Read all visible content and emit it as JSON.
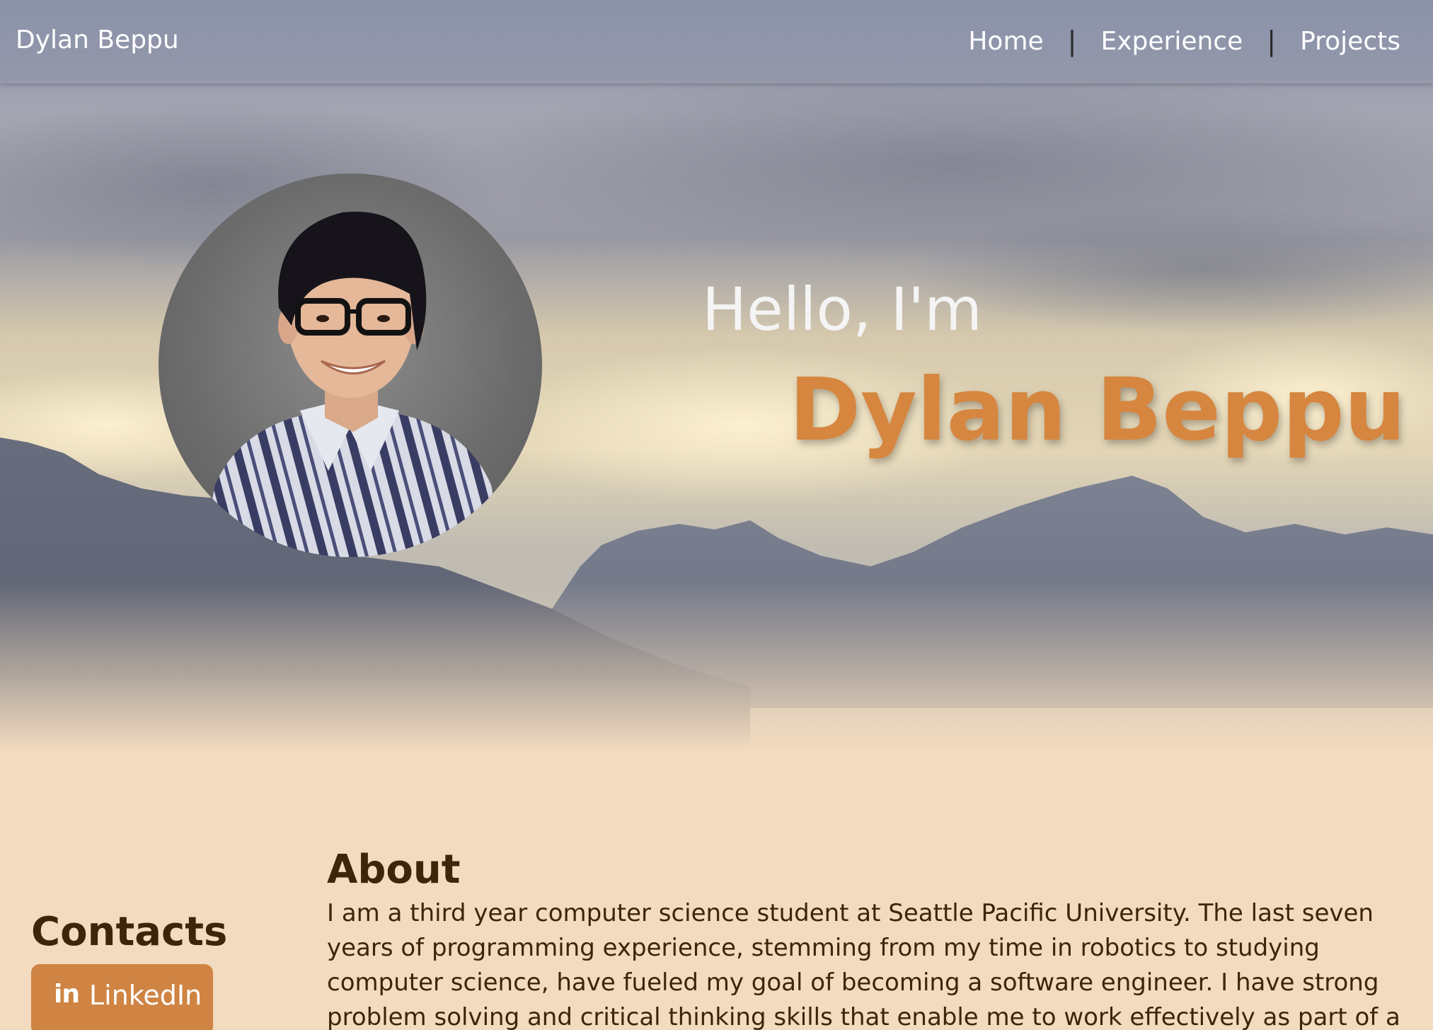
{
  "nav": {
    "brand": "Dylan Beppu",
    "links": [
      {
        "label": "Home"
      },
      {
        "label": "Experience"
      },
      {
        "label": "Projects"
      }
    ],
    "separator": "|"
  },
  "hero": {
    "greeting": "Hello, I'm",
    "name": "Dylan Beppu",
    "portrait_alt": "Portrait of Dylan Beppu",
    "name_color": "#d6863f"
  },
  "contacts": {
    "title": "Contacts",
    "linkedin": {
      "icon": "linkedin-icon",
      "icon_text": "in",
      "label": "LinkedIn"
    }
  },
  "about": {
    "title": "About",
    "text": "I am a third year computer science student at Seattle Pacific University. The last seven years of programming experience, stemming from my time in robotics to studying computer science, have fueled my goal of becoming a software engineer. I have strong problem solving and critical thinking skills that enable me to work effectively as part of a"
  },
  "colors": {
    "page_background": "#f2dbbf",
    "accent": "#cf8443",
    "heading_text": "#3d2608"
  }
}
